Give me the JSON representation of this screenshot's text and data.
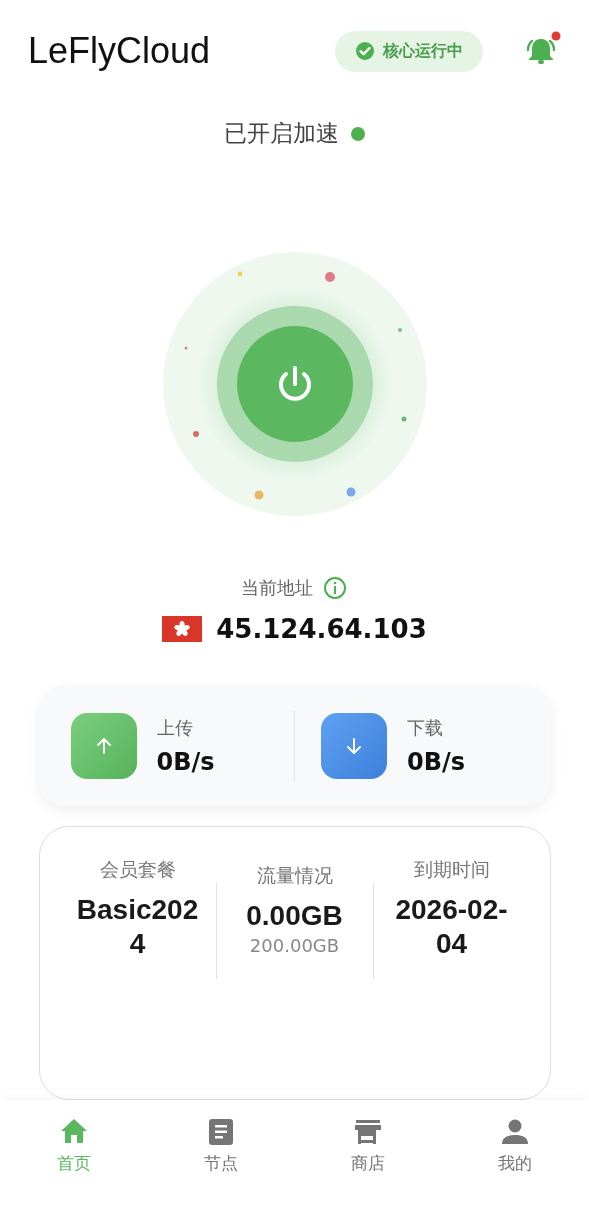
{
  "app": {
    "title": "LeFlyCloud"
  },
  "core_status": {
    "label": "核心运行中",
    "running": true
  },
  "notifications": {
    "unread": true
  },
  "connection": {
    "status": "已开启加速",
    "connected": true
  },
  "address": {
    "label": "当前地址",
    "ip": "45.124.64.103"
  },
  "speeds": [
    {
      "kind": "upload",
      "label": "上传",
      "value": "0B/s"
    },
    {
      "kind": "download",
      "label": "下载",
      "value": "0B/s"
    }
  ],
  "plan": [
    {
      "label": "会员套餐",
      "value": "Basic2024"
    },
    {
      "label": "流量情况",
      "value": "0.00GB",
      "sub": "200.00GB"
    },
    {
      "label": "到期时间",
      "value": "2026-02-04"
    }
  ],
  "tabs": [
    {
      "kind": "home",
      "label": "首页",
      "selected": true
    },
    {
      "kind": "nodes",
      "label": "节点",
      "selected": false
    },
    {
      "kind": "shop",
      "label": "商店",
      "selected": false
    },
    {
      "kind": "profile",
      "label": "我的",
      "selected": false
    }
  ]
}
